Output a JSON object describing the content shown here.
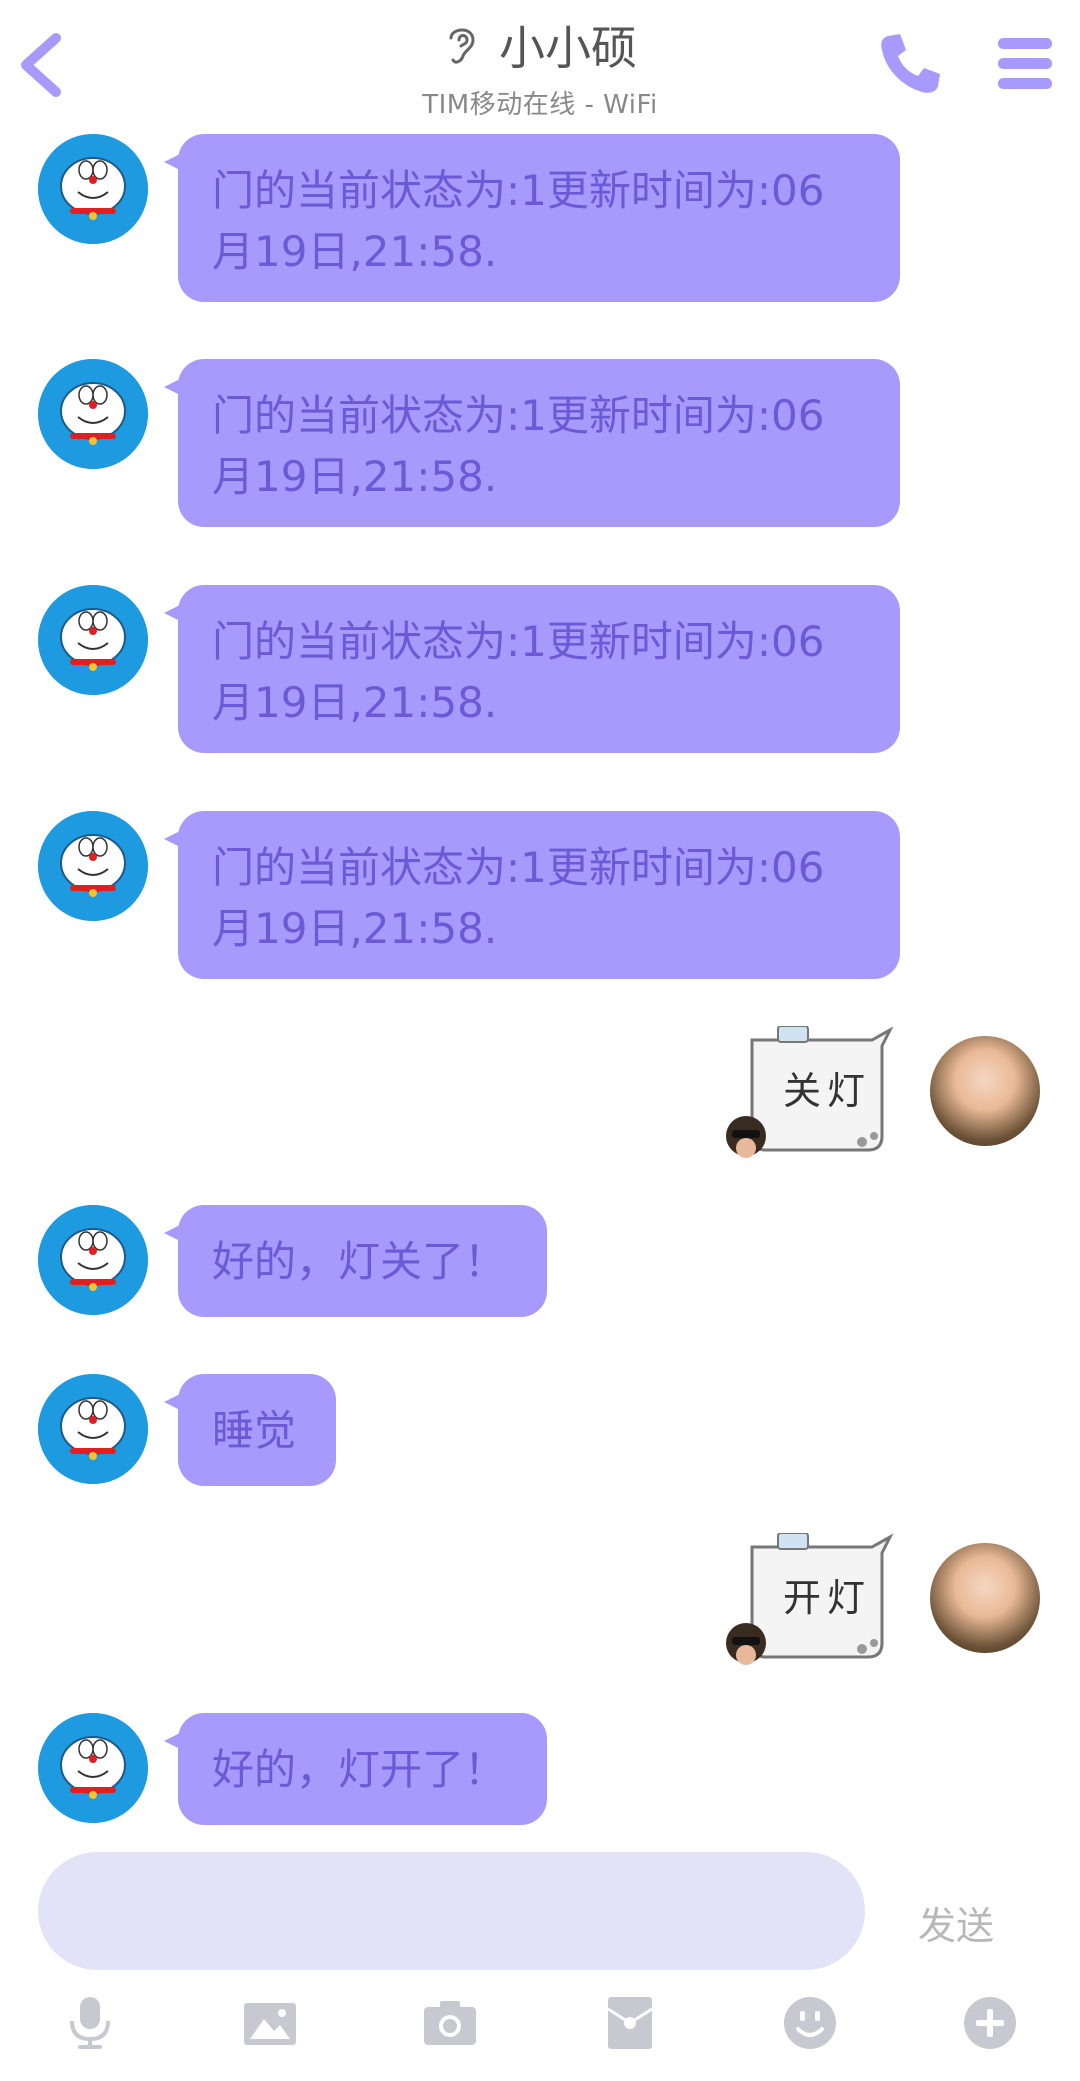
{
  "header": {
    "title": "小小硕",
    "subtitle": "TIM移动在线 - WiFi",
    "icons": [
      "back-icon",
      "ear-icon",
      "phone-icon",
      "menu-icon"
    ]
  },
  "messages": [
    {
      "side": "left",
      "text": "门的当前状态为:1更新时间为:06月19日,21:58."
    },
    {
      "side": "left",
      "text": "门的当前状态为:1更新时间为:06月19日,21:58."
    },
    {
      "side": "left",
      "text": "门的当前状态为:1更新时间为:06月19日,21:58."
    },
    {
      "side": "left",
      "text": "门的当前状态为:1更新时间为:06月19日,21:58."
    },
    {
      "side": "right",
      "sticker_text": "关灯"
    },
    {
      "side": "left",
      "text": "好的，灯关了！"
    },
    {
      "side": "left",
      "text": "睡觉"
    },
    {
      "side": "right",
      "sticker_text": "开灯"
    },
    {
      "side": "left",
      "text": "好的，灯开了！"
    }
  ],
  "input": {
    "placeholder": "",
    "send_label": "发送"
  },
  "toolbar": [
    "microphone-icon",
    "image-icon",
    "camera-icon",
    "red-packet-icon",
    "emoji-icon",
    "plus-icon"
  ],
  "colors": {
    "accent": "#a899fd",
    "bubble_text": "#6a5ad6",
    "input_bg": "#e3e3f7",
    "toolbar_icon": "#c8c8d0"
  }
}
